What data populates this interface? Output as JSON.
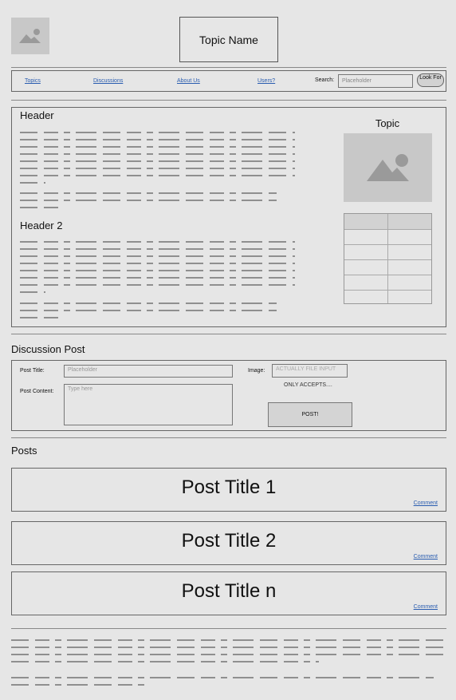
{
  "header": {
    "topic_name": "Topic Name",
    "logo_icon": "image-icon"
  },
  "nav": {
    "links": [
      "Topics",
      "Discussions",
      "About Us",
      "Users?"
    ],
    "search_label": "Search:",
    "search_placeholder": "Placeholder",
    "look_button": "Look For"
  },
  "article": {
    "header1": "Header",
    "header2": "Header 2",
    "side_title": "Topic",
    "side_image_icon": "image-icon"
  },
  "discussion": {
    "title": "Discussion Post",
    "post_title_label": "Post Title:",
    "post_title_placeholder": "Placeholder",
    "post_content_label": "Post Content:",
    "post_content_placeholder": "Type here",
    "image_label": "Image:",
    "file_input_placeholder": "ACTUALLY FILE INPUT",
    "only_accepts": "ONLY ACCEPTS....",
    "post_button": "POST!"
  },
  "posts": {
    "title": "Posts",
    "items": [
      {
        "title": "Post Title 1",
        "comment": "Comment"
      },
      {
        "title": "Post Title 2",
        "comment": "Comment"
      },
      {
        "title": "Post Title n",
        "comment": "Comment"
      }
    ]
  }
}
